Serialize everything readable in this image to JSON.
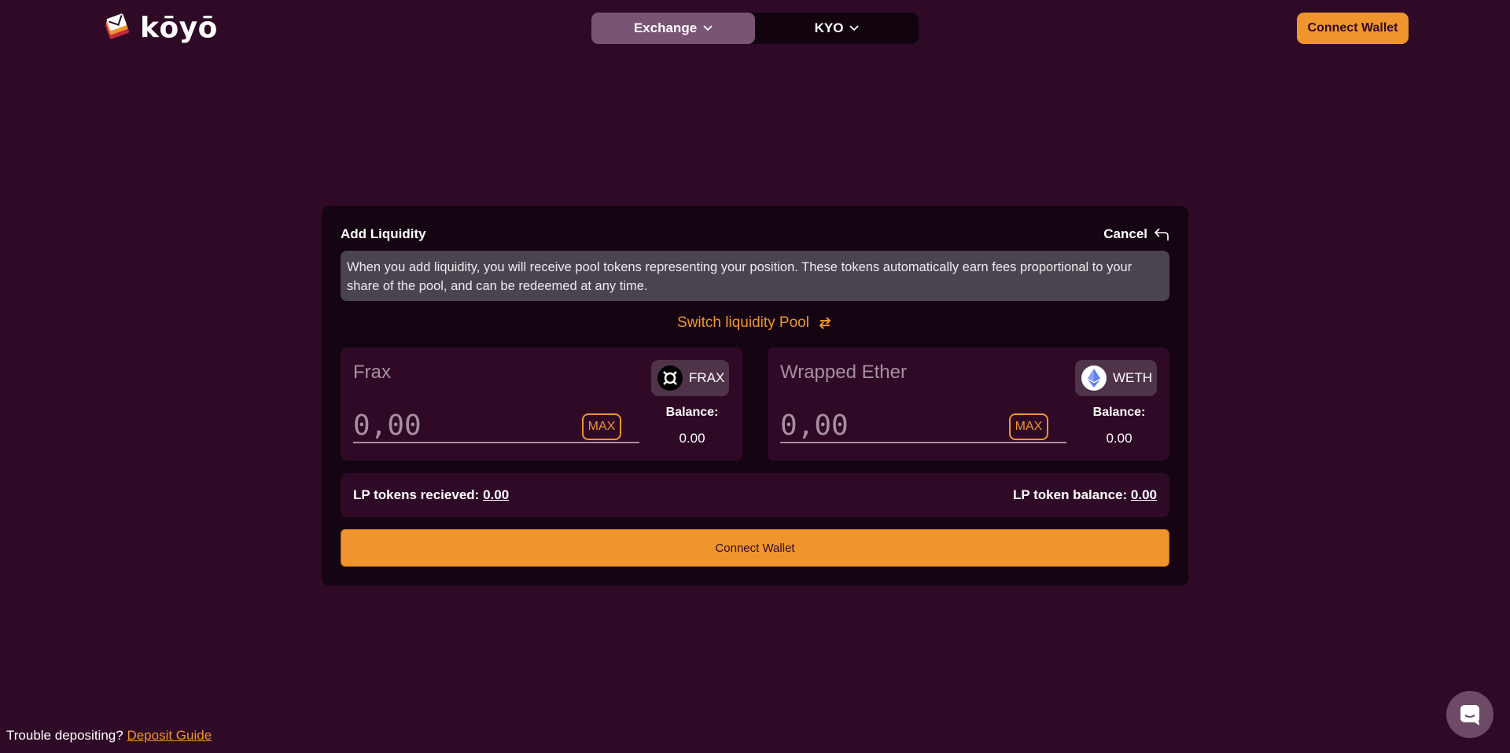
{
  "header": {
    "logo_text": "kōyō",
    "nav": [
      {
        "label": "Exchange",
        "active": true
      },
      {
        "label": "KYO",
        "active": false
      }
    ],
    "connect_label": "Connect Wallet"
  },
  "card": {
    "title": "Add Liquidity",
    "cancel_label": "Cancel",
    "info_text": "When you add liquidity, you will receive pool tokens representing your position. These tokens automatically earn fees proportional to your share of the pool, and can be redeemed at any time.",
    "switch_label": "Switch liquidity Pool",
    "tokens": [
      {
        "name": "Frax",
        "symbol": "FRAX",
        "icon": "frax-icon",
        "placeholder": "0,00",
        "max_label": "MAX",
        "balance_label": "Balance:",
        "balance": "0.00"
      },
      {
        "name": "Wrapped Ether",
        "symbol": "WETH",
        "icon": "ethereum-icon",
        "placeholder": "0,00",
        "max_label": "MAX",
        "balance_label": "Balance:",
        "balance": "0.00"
      }
    ],
    "lp_received_label": "LP tokens recieved:",
    "lp_received_value": "0.00",
    "lp_balance_label": "LP token balance:",
    "lp_balance_value": "0.00",
    "connect_label": "Connect Wallet"
  },
  "footer": {
    "help_text": "Trouble depositing?",
    "help_link": "Deposit Guide"
  },
  "colors": {
    "background": "#2e0a27",
    "card": "#150412",
    "accent": "#f0952e"
  }
}
